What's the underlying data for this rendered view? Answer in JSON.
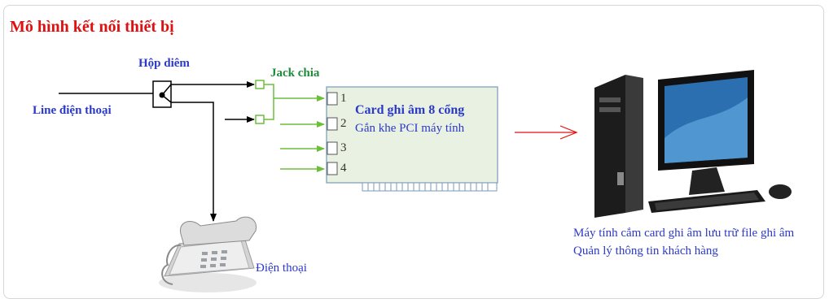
{
  "title": "Mô hình kết nối thiết bị",
  "labels": {
    "hop_diem": "Hộp diêm",
    "jack_chia": "Jack chia",
    "line": "Line điện thoại",
    "dien_thoai": "Điện thoại"
  },
  "card": {
    "title": "Card ghi âm 8 cổng",
    "subtitle": "Gắn khe PCI máy tính",
    "ports": [
      "1",
      "2",
      "3",
      "4"
    ]
  },
  "computer": {
    "caption_line1": "Máy tính cắm card ghi âm lưu trữ file ghi âm",
    "caption_line2": "Quản lý thông tin khách hàng"
  },
  "colors": {
    "title": "#e01010",
    "label_blue": "#2b39c8",
    "jack_green": "#6cbf3a",
    "card_fill": "#e9f2e2",
    "red_arrow": "#e01010"
  }
}
